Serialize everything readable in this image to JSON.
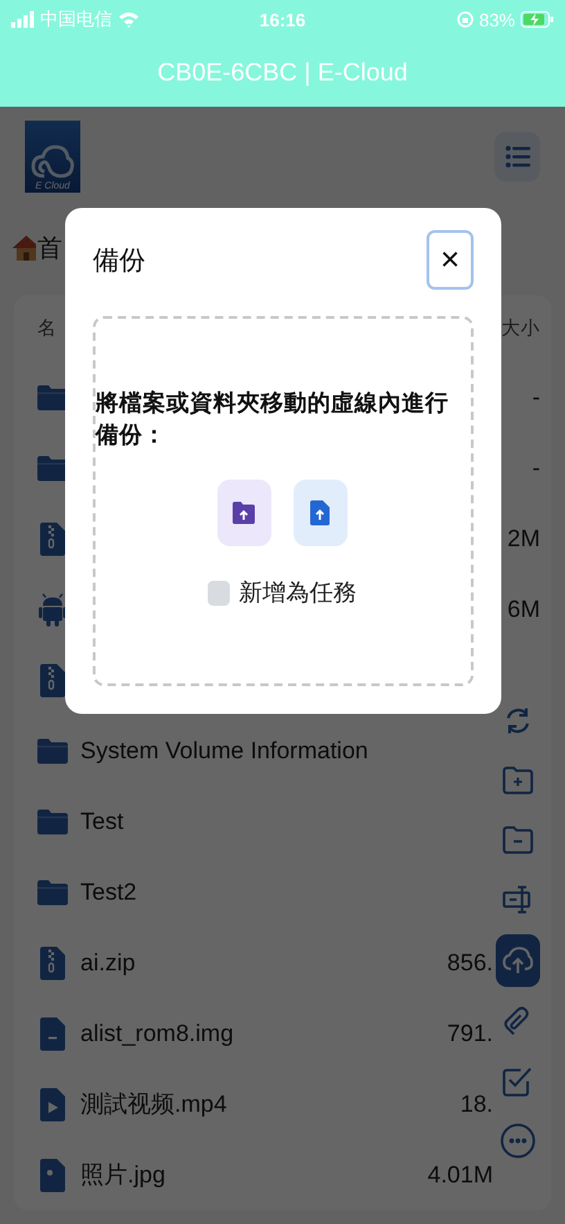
{
  "status_bar": {
    "carrier": "中国电信",
    "time": "16:16",
    "battery": "83%"
  },
  "title_bar": {
    "title": "CB0E-6CBC | E-Cloud"
  },
  "header": {
    "logo_text": "E Cloud"
  },
  "breadcrumb": {
    "text": "首"
  },
  "file_list": {
    "columns": [
      "名",
      "大小"
    ],
    "rows": [
      {
        "kind": "folder",
        "size": "-"
      },
      {
        "kind": "folder",
        "size": "-"
      },
      {
        "kind": "zip",
        "size": "2M"
      },
      {
        "kind": "apk",
        "size": "6M"
      },
      {
        "kind": "zip"
      },
      {
        "kind": "folder",
        "name": "System Volume Information"
      },
      {
        "kind": "folder",
        "name": "Test"
      },
      {
        "kind": "folder",
        "name": "Test2"
      },
      {
        "kind": "zip",
        "name": "ai.zip",
        "size": "856."
      },
      {
        "kind": "file",
        "name": "alist_rom8.img",
        "size": "791."
      },
      {
        "kind": "video",
        "name": "測試视频.mp4",
        "size": "18."
      },
      {
        "kind": "image",
        "name": "照片.jpg",
        "size": "4.01M"
      }
    ]
  },
  "toolbar": {
    "items": [
      {
        "kind": "refresh",
        "selected": false
      },
      {
        "kind": "new-folder",
        "selected": false
      },
      {
        "kind": "remove-folder",
        "selected": false
      },
      {
        "kind": "rename",
        "selected": false
      },
      {
        "kind": "upload",
        "selected": true
      },
      {
        "kind": "link",
        "selected": false
      },
      {
        "kind": "select",
        "selected": false
      },
      {
        "kind": "more",
        "selected": false
      }
    ]
  },
  "dialog": {
    "title": "備份",
    "close": "×",
    "message": "將檔案或資料夾移動的虛線內進行備份：",
    "task_checkbox": {
      "label": "新增為任務",
      "checked": false
    }
  }
}
